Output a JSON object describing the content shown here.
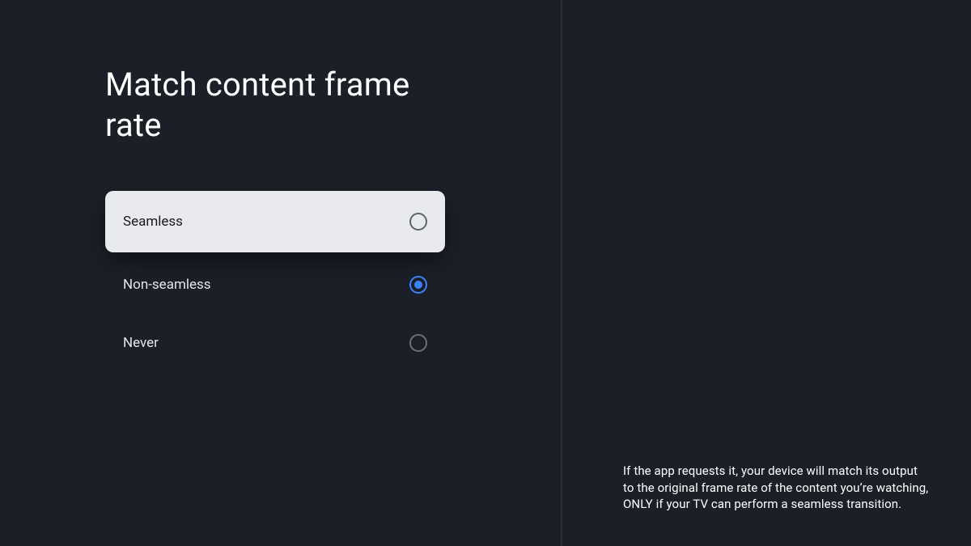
{
  "title": "Match content frame rate",
  "selected_value": "Non-seamless",
  "focused_value": "Seamless",
  "options": [
    {
      "label": "Seamless"
    },
    {
      "label": "Non-seamless"
    },
    {
      "label": "Never"
    }
  ],
  "description": "If the app requests it, your device will match its output to the original frame rate of the content you’re watching, ONLY if your TV can perform a seamless transition."
}
